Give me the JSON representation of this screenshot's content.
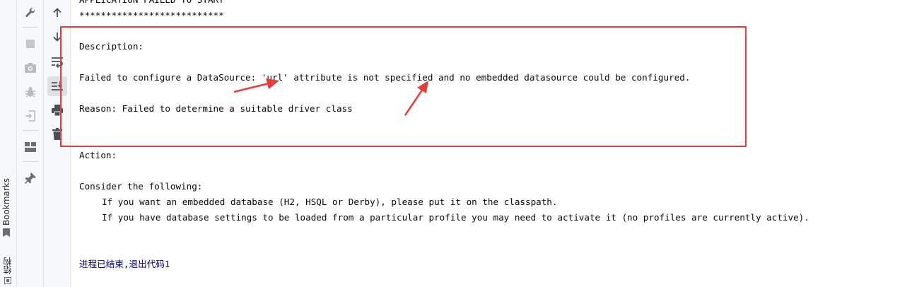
{
  "side_tabs": {
    "bookmarks_label": "Bookmarks",
    "structure_label": "结构"
  },
  "toolbar_left": {
    "icons": [
      "wrench-icon",
      "stop-icon",
      "camera-icon",
      "bug-icon",
      "login-icon",
      "layout-icon",
      "pin-icon"
    ]
  },
  "toolbar_right": {
    "icons": [
      "arrow-up-icon",
      "arrow-down-icon",
      "soft-wrap-icon",
      "scroll-to-end-icon",
      "print-icon",
      "trash-icon"
    ]
  },
  "console": {
    "header_title": "APPLICATION FAILED TO START",
    "stars": "***************************",
    "description_label": "Description:",
    "description_text": "Failed to configure a DataSource: 'url' attribute is not specified and no embedded datasource could be configured.",
    "reason_text": "Reason: Failed to determine a suitable driver class",
    "action_label": "Action:",
    "consider_text": "Consider the following:",
    "suggestion_1": "If you want an embedded database (H2, HSQL or Derby), please put it on the classpath.",
    "suggestion_2": "If you have database settings to be loaded from a particular profile you may need to activate it (no profiles are currently active).",
    "exit_message": "进程已结束,退出代码1"
  },
  "annotations": {
    "box_color": "#e83b3b",
    "arrow_color": "#e83b3b"
  }
}
